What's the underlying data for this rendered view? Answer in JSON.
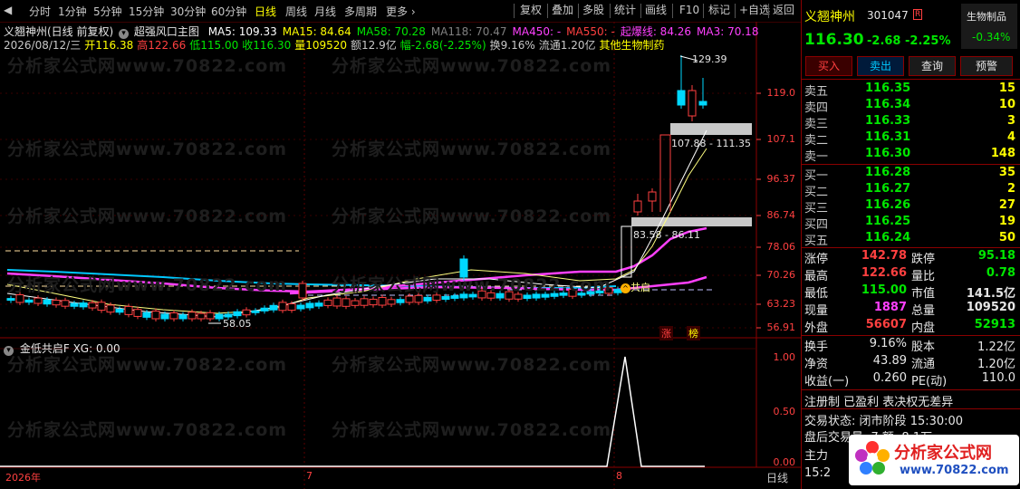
{
  "toolbar": {
    "periods": [
      "分时",
      "1分钟",
      "5分钟",
      "15分钟",
      "30分钟",
      "60分钟",
      "日线",
      "周线",
      "月线",
      "多周期",
      "更多"
    ],
    "active_period": "日线",
    "right_buttons": [
      "复权",
      "叠加",
      "多股",
      "统计",
      "画线",
      "F10",
      "标记",
      "+自选",
      "返回"
    ]
  },
  "chart_header": {
    "stock": "义翘神州(日线 前复权)",
    "indicator": "超强风口主图",
    "ma": [
      {
        "label": "MA5: 109.33",
        "color": "#ffffff"
      },
      {
        "label": "MA15: 84.64",
        "color": "#ffff00"
      },
      {
        "label": "MA58: 70.28",
        "color": "#00e600"
      },
      {
        "label": "MA118: 70.47",
        "color": "#808080"
      },
      {
        "label": "MA450: -",
        "color": "#ff40ff"
      },
      {
        "label": "MA550: -",
        "color": "#ff4040"
      },
      {
        "label": "起爆线: 84.26",
        "color": "#ff40ff"
      },
      {
        "label": "MA3: 70.18",
        "color": "#ff40ff"
      }
    ],
    "line2": [
      {
        "label": "2026/08/12/三",
        "color": "#c8c8c8"
      },
      {
        "label": "开116.38",
        "color": "#ffff00"
      },
      {
        "label": "高122.66",
        "color": "#ff4040"
      },
      {
        "label": "低115.00",
        "color": "#00e600"
      },
      {
        "label": "收116.30",
        "color": "#00e600"
      },
      {
        "label": "量109520",
        "color": "#ffff00"
      },
      {
        "label": "额12.9亿",
        "color": "#c8c8c8"
      },
      {
        "label": "幅-2.68(-2.25%)",
        "color": "#00e600"
      },
      {
        "label": "换9.16%",
        "color": "#c8c8c8"
      },
      {
        "label": "流通1.20亿",
        "color": "#c8c8c8"
      },
      {
        "label": "其他生物制药",
        "color": "#ffff00"
      }
    ]
  },
  "price_axis": [
    "119.0",
    "107.1",
    "96.37",
    "86.74",
    "78.06",
    "70.26",
    "63.23",
    "56.91"
  ],
  "chart_annotations": {
    "high": "129.39",
    "low": "58.05",
    "range_top": "107.88 - 111.35",
    "range_bottom": "83.58 - 86.11",
    "signal": "共启",
    "tag_zhang": "涨",
    "tag_bang": "榜"
  },
  "sub_indicator": {
    "title": "金低共启F",
    "value": "XG: 0.00",
    "axis": [
      "1.00",
      "0.50",
      "0.00"
    ]
  },
  "time_axis": {
    "labels": [
      "2026年",
      "7",
      "8"
    ],
    "period_label": "日线"
  },
  "watermark": "分析家公式网www.70822.com",
  "quote": {
    "name": "义翘神州",
    "code": "301047",
    "flag": "R",
    "sector": "生物制品",
    "sector_change": "-0.34%",
    "price": "116.30",
    "change": "-2.68",
    "change_pct": "-2.25%",
    "buttons": [
      "买入",
      "卖出",
      "查询",
      "预警"
    ],
    "asks": [
      {
        "label": "卖五",
        "price": "116.35",
        "vol": "15"
      },
      {
        "label": "卖四",
        "price": "116.34",
        "vol": "10"
      },
      {
        "label": "卖三",
        "price": "116.33",
        "vol": "3"
      },
      {
        "label": "卖二",
        "price": "116.31",
        "vol": "4"
      },
      {
        "label": "卖一",
        "price": "116.30",
        "vol": "148"
      }
    ],
    "bids": [
      {
        "label": "买一",
        "price": "116.28",
        "vol": "35"
      },
      {
        "label": "买二",
        "price": "116.27",
        "vol": "2"
      },
      {
        "label": "买三",
        "price": "116.26",
        "vol": "27"
      },
      {
        "label": "买四",
        "price": "116.25",
        "vol": "19"
      },
      {
        "label": "买五",
        "price": "116.24",
        "vol": "50"
      }
    ],
    "stats": [
      {
        "l1": "涨停",
        "v1": "142.78",
        "c1": "#ff4040",
        "l2": "跌停",
        "v2": "95.18",
        "c2": "#00e600"
      },
      {
        "l1": "最高",
        "v1": "122.66",
        "c1": "#ff4040",
        "l2": "量比",
        "v2": "0.78",
        "c2": "#00e600"
      },
      {
        "l1": "最低",
        "v1": "115.00",
        "c1": "#00e600",
        "l2": "市值",
        "v2": "141.5亿",
        "c2": "#e6e6e6"
      },
      {
        "l1": "现量",
        "v1": "1887",
        "c1": "#ff40ff",
        "l2": "总量",
        "v2": "109520",
        "c2": "#e6e6e6"
      },
      {
        "l1": "外盘",
        "v1": "56607",
        "c1": "#ff4040",
        "l2": "内盘",
        "v2": "52913",
        "c2": "#00e600"
      }
    ],
    "stats2": [
      {
        "l1": "换手",
        "v1": "9.16%",
        "l2": "股本",
        "v2": "1.22亿"
      },
      {
        "l1": "净资",
        "v1": "43.89",
        "l2": "流通",
        "v2": "1.20亿"
      },
      {
        "l1": "收益(一)",
        "v1": "0.260",
        "l2": "PE(动)",
        "v2": "110.0"
      }
    ],
    "info_line": "注册制 已盈利 表决权无差异",
    "trade_status_label": "交易状态:",
    "trade_status": "闭市阶段",
    "trade_time": "15:30:00",
    "after_hours": "盘后交易量: 7 额: 8.1万",
    "main_label": "主力",
    "clock": "15:2",
    "logo_text": "分析家公式网",
    "logo_url": "www.70822.com"
  }
}
